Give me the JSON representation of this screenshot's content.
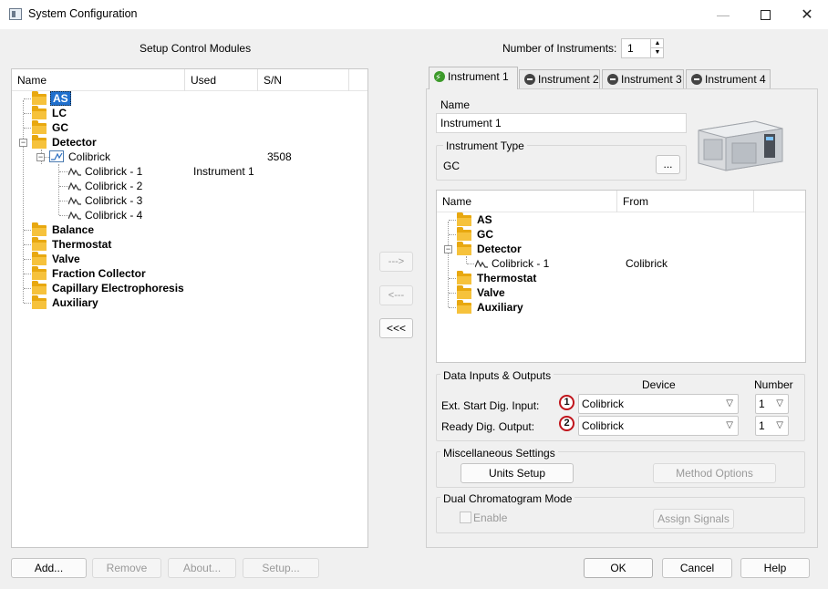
{
  "window": {
    "title": "System Configuration"
  },
  "left": {
    "heading": "Setup Control Modules",
    "columns": [
      "Name",
      "Used",
      "S/N"
    ],
    "tree": {
      "as": "AS",
      "lc": "LC",
      "gc": "GC",
      "detector": "Detector",
      "colibrick": "Colibrick",
      "colibrick_sn": "3508",
      "ch1": "Colibrick - 1",
      "ch1_used": "Instrument 1",
      "ch2": "Colibrick - 2",
      "ch3": "Colibrick - 3",
      "ch4": "Colibrick - 4",
      "balance": "Balance",
      "thermostat": "Thermostat",
      "valve": "Valve",
      "fraction": "Fraction Collector",
      "capillary": "Capillary Electrophoresis",
      "auxiliary": "Auxiliary"
    },
    "buttons": {
      "add": "Add...",
      "remove": "Remove",
      "about": "About...",
      "setup": "Setup..."
    }
  },
  "middle": {
    "add_one": "--->",
    "remove_one": "<---",
    "remove_all": "<<<"
  },
  "instruments": {
    "count_label": "Number of Instruments:",
    "count": "1",
    "tabs": [
      "Instrument 1",
      "Instrument 2",
      "Instrument 3",
      "Instrument 4"
    ]
  },
  "instrument": {
    "name_label": "Name",
    "name_value": "Instrument 1",
    "type_label": "Instrument Type",
    "type_value": "GC",
    "browse": "...",
    "columns": [
      "Name",
      "From"
    ],
    "tree": {
      "as": "AS",
      "gc": "GC",
      "detector": "Detector",
      "ch1": "Colibrick - 1",
      "ch1_from": "Colibrick",
      "thermostat": "Thermostat",
      "valve": "Valve",
      "auxiliary": "Auxiliary"
    }
  },
  "io": {
    "title": "Data Inputs & Outputs",
    "device_header": "Device",
    "number_header": "Number",
    "row1_label": "Ext. Start Dig. Input:",
    "row1_badge": "1",
    "row1_device": "Colibrick",
    "row1_number": "1",
    "row2_label": "Ready Dig. Output:",
    "row2_badge": "2",
    "row2_device": "Colibrick",
    "row2_number": "1"
  },
  "misc": {
    "title": "Miscellaneous Settings",
    "units": "Units Setup",
    "method": "Method Options"
  },
  "dual": {
    "title": "Dual Chromatogram Mode",
    "enable": "Enable",
    "assign": "Assign Signals"
  },
  "footer": {
    "ok": "OK",
    "cancel": "Cancel",
    "help": "Help"
  },
  "colors": {
    "folder": "#f6c23c",
    "selection": "#1f6fcd",
    "badge_ring": "#c0141b",
    "tab_active_icon": "#3c9a2a"
  }
}
